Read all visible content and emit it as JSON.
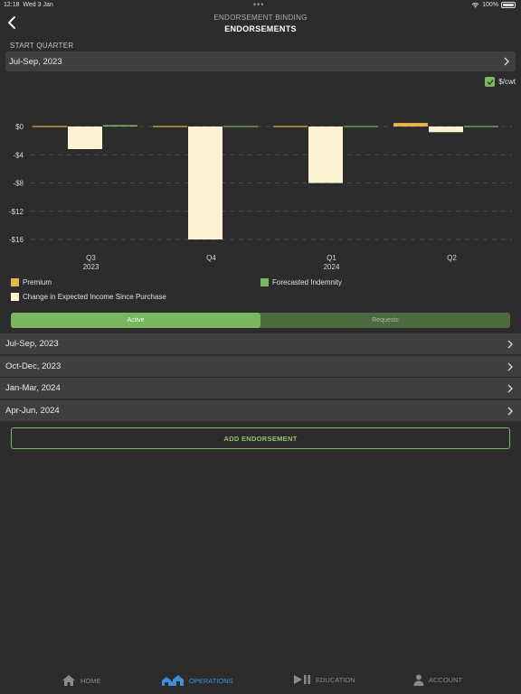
{
  "status_bar": {
    "time": "12:18",
    "date": "Wed 3 Jan",
    "battery": "100%"
  },
  "header": {
    "subtitle": "ENDORSEMENT BINDING",
    "title": "ENDORSEMENTS"
  },
  "start_quarter": {
    "label": "START QUARTER",
    "value": "Jul-Sep, 2023"
  },
  "units_toggle": {
    "label": "$/cwt",
    "checked": true
  },
  "chart_data": {
    "type": "bar",
    "categories": [
      "Q3",
      "Q4",
      "Q1",
      "Q2"
    ],
    "category_years": [
      "2023",
      "",
      "2024",
      ""
    ],
    "y_ticks": [
      "$0",
      "-$4",
      "-$8",
      "-$12",
      "-$16"
    ],
    "ylim": [
      -16,
      0
    ],
    "series": [
      {
        "name": "Premium",
        "color": "#e9b449",
        "values": [
          0,
          0,
          0,
          0.5
        ]
      },
      {
        "name": "Change in Expected Income Since Purchase",
        "color": "#fdf3d3",
        "values": [
          -3.2,
          -16,
          -8,
          -0.8
        ]
      },
      {
        "name": "Forecasted Indemnity",
        "color": "#7bb661",
        "values": [
          0.2,
          0,
          0,
          0
        ]
      }
    ],
    "grid": true,
    "legend_position": "bottom"
  },
  "segments": {
    "active": "Active",
    "requests": "Requests"
  },
  "endorsements": [
    {
      "label": "Jul-Sep, 2023"
    },
    {
      "label": "Oct-Dec, 2023"
    },
    {
      "label": "Jan-Mar, 2024"
    },
    {
      "label": "Apr-Jun, 2024"
    }
  ],
  "add_button": "ADD ENDORSEMENT",
  "tabbar": {
    "home": "HOME",
    "operations": "OPERATIONS",
    "education": "EDUCATION",
    "account": "ACCOUNT"
  },
  "colors": {
    "accent_green": "#7bb661",
    "active_tab": "#3d8fd8",
    "background": "#2c2c2c",
    "row": "#3f3f3f"
  }
}
